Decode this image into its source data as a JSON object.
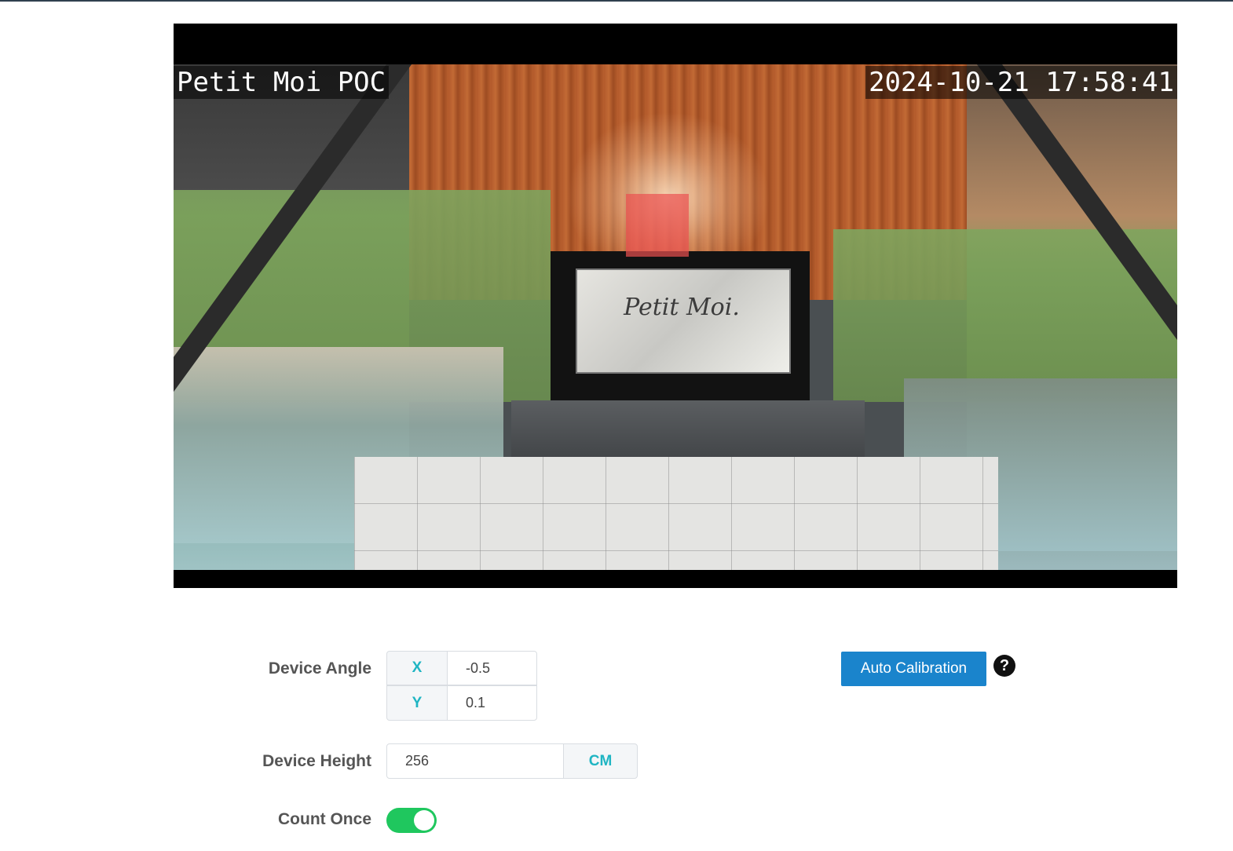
{
  "camera": {
    "name_overlay": "Petit Moi POC",
    "timestamp_overlay": "2024-10-21 17:58:41",
    "door_sign": "Petit Moi."
  },
  "form": {
    "device_angle": {
      "label": "Device Angle",
      "x_label": "X",
      "x_value": "-0.5",
      "y_label": "Y",
      "y_value": "0.1"
    },
    "device_height": {
      "label": "Device Height",
      "value": "256",
      "unit": "CM"
    },
    "count_once": {
      "label": "Count Once",
      "enabled": true
    },
    "auto_calibration_label": "Auto Calibration",
    "help_symbol": "?"
  },
  "colors": {
    "accent": "#1fb5c3",
    "button": "#1a84cc",
    "toggle_on": "#1fc75e",
    "marker": "#eb5050"
  }
}
